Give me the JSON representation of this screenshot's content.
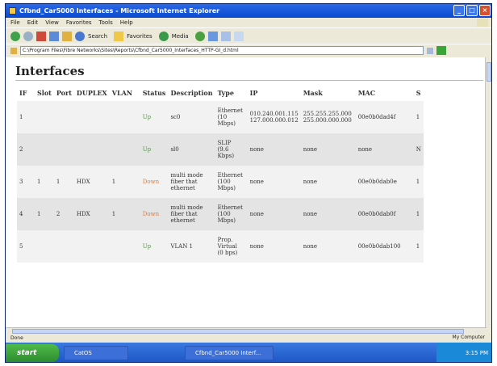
{
  "window": {
    "title": "Cfbnd_Car5000 Interfaces - Microsoft Internet Explorer"
  },
  "menu": {
    "items": [
      "File",
      "Edit",
      "View",
      "Favorites",
      "Tools",
      "Help"
    ]
  },
  "toolbar": {
    "search_label": "Search",
    "favorites_label": "Favorites",
    "media_label": "Media"
  },
  "address": {
    "url": "C:\\Program Files\\Fibre Networks\\Sites\\Reports\\Cfbnd_Car5000_Interfaces_HTTP-GI_d.html"
  },
  "page": {
    "title": "Interfaces"
  },
  "table": {
    "columns": [
      "IF",
      "Slot",
      "Port",
      "DUPLEX",
      "VLAN",
      "Status",
      "Description",
      "Type",
      "IP",
      "Mask",
      "MAC",
      "S"
    ],
    "rows": [
      {
        "if": "1",
        "slot": "",
        "port": "",
        "duplex": "",
        "vlan": "",
        "status": "Up",
        "status_state": "up",
        "description": "sc0",
        "type": [
          "Ethernet",
          "(10",
          "Mbps)"
        ],
        "ip": [
          "010.240.001.115",
          "127.000.000.012"
        ],
        "mask": [
          "255.255.255.000",
          "255.000.000.000"
        ],
        "mac": "00e0b0dad4f",
        "s": "1"
      },
      {
        "if": "2",
        "slot": "",
        "port": "",
        "duplex": "",
        "vlan": "",
        "status": "Up",
        "status_state": "up",
        "description": "sl0",
        "type": [
          "SLIP",
          "(9.6",
          "Kbps)"
        ],
        "ip": [
          "none"
        ],
        "mask": [
          "none"
        ],
        "mac": "none",
        "s": "N"
      },
      {
        "if": "3",
        "slot": "1",
        "port": "1",
        "duplex": "HDX",
        "vlan": "1",
        "status": "Down",
        "status_state": "down",
        "description": [
          "multi mode",
          "fiber that",
          "ethernet"
        ],
        "type": [
          "Ethernet",
          "(100",
          "Mbps)"
        ],
        "ip": [
          "none"
        ],
        "mask": [
          "none"
        ],
        "mac": "00e0b0dab0e",
        "s": "1"
      },
      {
        "if": "4",
        "slot": "1",
        "port": "2",
        "duplex": "HDX",
        "vlan": "1",
        "status": "Down",
        "status_state": "down",
        "description": [
          "multi mode",
          "fiber that",
          "ethernet"
        ],
        "type": [
          "Ethernet",
          "(100",
          "Mbps)"
        ],
        "ip": [
          "none"
        ],
        "mask": [
          "none"
        ],
        "mac": "00e0b0dab0f",
        "s": "1"
      },
      {
        "if": "5",
        "slot": "",
        "port": "",
        "duplex": "",
        "vlan": "",
        "status": "Up",
        "status_state": "up",
        "description": "VLAN 1",
        "type": [
          "Prop.",
          "Virtual",
          "(0 bps)"
        ],
        "ip": [
          "none"
        ],
        "mask": [
          "none"
        ],
        "mac": "00e0b0dab100",
        "s": "1"
      }
    ]
  },
  "statusbar": {
    "left": "Done",
    "zone": "My Computer"
  },
  "taskbar": {
    "start_label": "start",
    "tasks": [
      "CatOS",
      "Cfbnd_Car5000 Interf..."
    ],
    "clock": "3:15 PM"
  },
  "colors": {
    "status_up": "#4a9c3c",
    "status_down": "#e07a3c"
  }
}
